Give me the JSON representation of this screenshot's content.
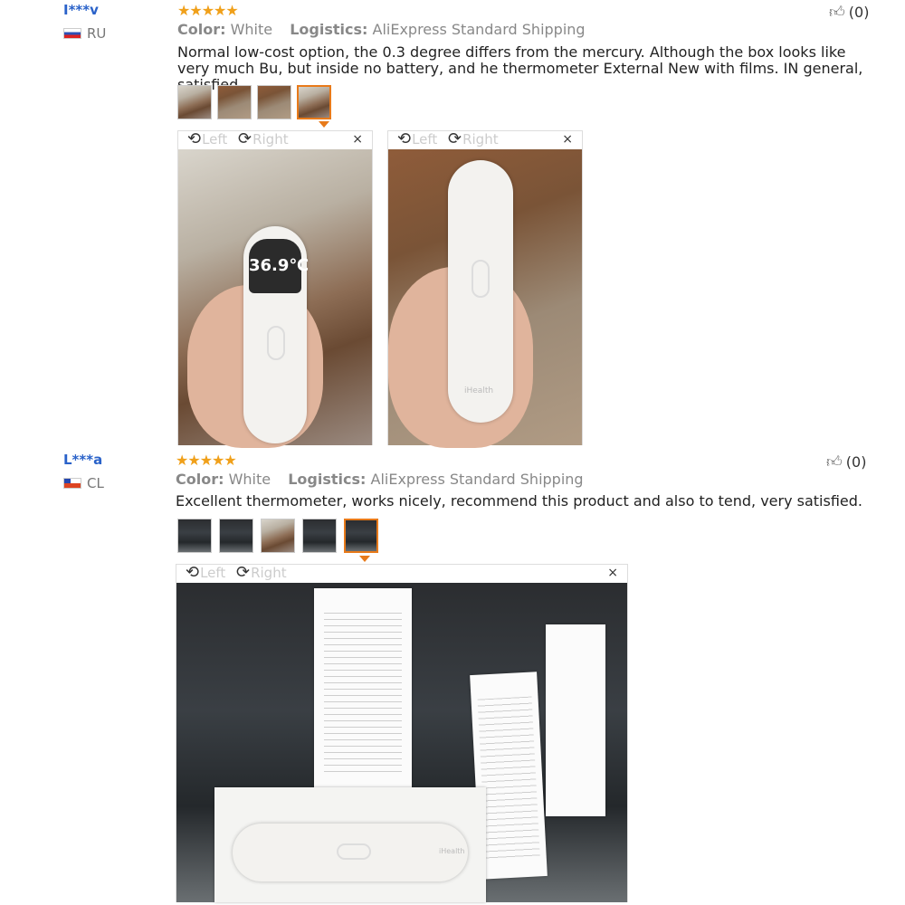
{
  "reviews": [
    {
      "user": "I***v",
      "country": "RU",
      "stars": "★★★★★",
      "color_label": "Color:",
      "color_value": "White",
      "logistics_label": "Logistics:",
      "logistics_value": "AliExpress Standard Shipping",
      "text": "Normal low-cost option, the 0.3 degree differs from the mercury. Although the box looks like very much Bu, but inside no battery, and he thermometer External New with films. IN general, satisfied.",
      "likes": "(0)",
      "thumbnails": 4,
      "viewers": [
        {
          "rotate_left": "Left",
          "rotate_right": "Right",
          "close": "×",
          "display_reading": "36.9℃"
        },
        {
          "rotate_left": "Left",
          "rotate_right": "Right",
          "close": "×",
          "brand": "iHealth"
        }
      ]
    },
    {
      "user": "L***a",
      "country": "CL",
      "stars": "★★★★★",
      "color_label": "Color:",
      "color_value": "White",
      "logistics_label": "Logistics:",
      "logistics_value": "AliExpress Standard Shipping",
      "text": "Excellent thermometer, works nicely, recommend this product and also to tend, very satisfied.",
      "likes": "(0)",
      "thumbnails": 5,
      "viewers": [
        {
          "rotate_left": "Left",
          "rotate_right": "Right",
          "close": "×",
          "brand": "iHealth"
        }
      ]
    }
  ],
  "icons": {
    "star": "star-icon",
    "thumbs_up": "thumbs-up-icon",
    "rotate_left": "rotate-left-icon",
    "rotate_right": "rotate-right-icon",
    "close": "close-icon"
  },
  "colors": {
    "username": "#2a62c9",
    "stars": "#f0a01a",
    "active_thumb": "#e87a1a"
  }
}
